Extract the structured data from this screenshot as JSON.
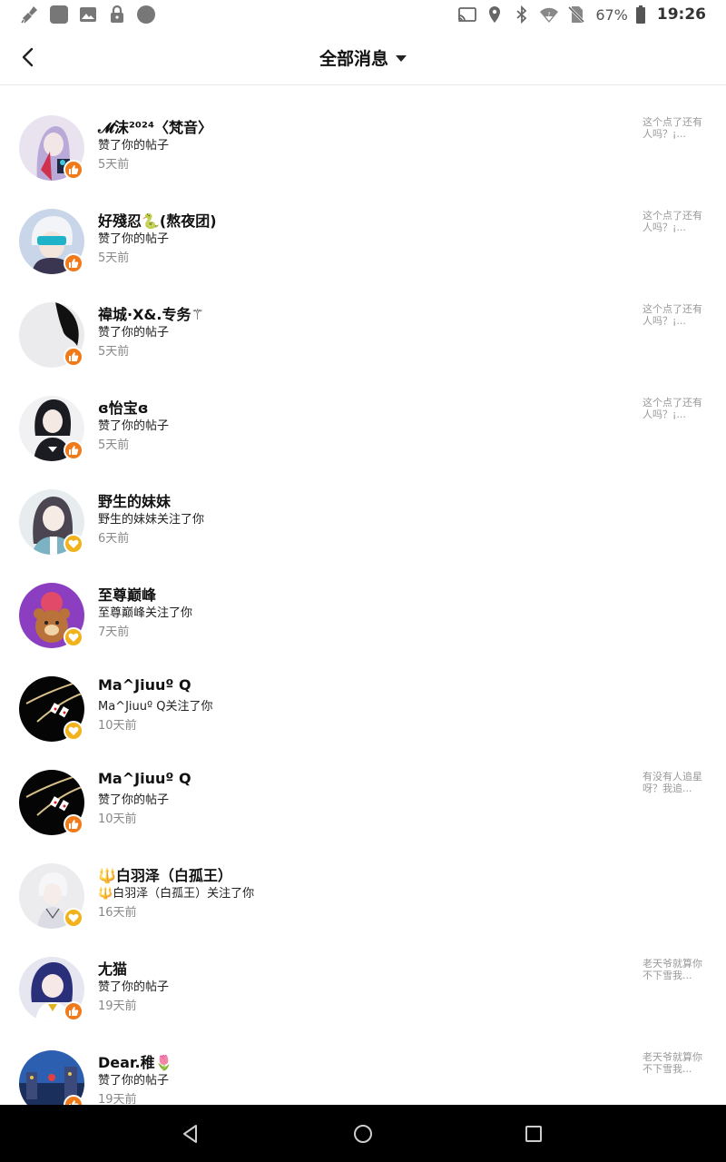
{
  "status_bar": {
    "left_icons": [
      "broom-icon",
      "app-square-icon",
      "image-icon",
      "lock-icon",
      "circle-icon"
    ],
    "right_icons": [
      "cast-icon",
      "location-icon",
      "bluetooth-icon",
      "wifi-icon",
      "no-sim-icon",
      "battery-icon"
    ],
    "battery": "67%",
    "time": "19:26"
  },
  "header": {
    "back_icon": "chevron-left-icon",
    "title": "全部消息",
    "caret_icon": "caret-down-icon"
  },
  "colors": {
    "like_badge": "#f07a1a",
    "follow_badge": "#f2b21b",
    "muted_text": "#888888",
    "preview_text": "#999999"
  },
  "notifications": [
    {
      "name": "𝓜沫²⁰²⁴〈梵音〉",
      "action": "赞了你的帖子",
      "time": "5天前",
      "preview": "这个点了还有人吗？¡...",
      "badge": "like",
      "avatar": "purple-hair-avatar"
    },
    {
      "name": "好殘忍🐍(熬夜团)",
      "action": "赞了你的帖子",
      "time": "5天前",
      "preview": "这个点了还有人吗？¡...",
      "badge": "like",
      "avatar": "white-hair-visor-avatar"
    },
    {
      "name": "禕城·X&.专务⚚",
      "action": "赞了你的帖子",
      "time": "5天前",
      "preview": "这个点了还有人吗？¡...",
      "badge": "like",
      "avatar": "white-black-avatar"
    },
    {
      "name": "ɞ怡宝ɞ",
      "action": "赞了你的帖子",
      "time": "5天前",
      "preview": "这个点了还有人吗？¡...",
      "badge": "like",
      "avatar": "dark-hair-girl-avatar"
    },
    {
      "name": "野生的妹妹",
      "action": "野生的妹妹关注了你",
      "time": "6天前",
      "preview": "",
      "badge": "follow",
      "avatar": "anime-girl-avatar"
    },
    {
      "name": "至尊巅峰",
      "action": "至尊巅峰关注了你",
      "time": "7天前",
      "preview": "",
      "badge": "follow",
      "avatar": "purple-bear-avatar"
    },
    {
      "name": "Ma^Jiuuº Q",
      "action": "Ma^Jiuuº Q关注了你",
      "time": "10天前",
      "preview": "",
      "badge": "follow",
      "avatar": "black-chain-avatar"
    },
    {
      "name": "Ma^Jiuuº Q",
      "action": "赞了你的帖子",
      "time": "10天前",
      "preview": "有没有人追星呀？我追...",
      "badge": "like",
      "avatar": "black-chain-avatar"
    },
    {
      "name": "🔱白羽泽（白孤王）",
      "action": "🔱白羽泽（白孤王）关注了你",
      "time": "16天前",
      "preview": "",
      "badge": "follow",
      "avatar": "white-boy-avatar"
    },
    {
      "name": "尢猫",
      "action": "赞了你的帖子",
      "time": "19天前",
      "preview": "老天爷就算你不下雪我...",
      "badge": "like",
      "avatar": "navy-hair-avatar"
    },
    {
      "name": "Dear.稚🌷",
      "action": "赞了你的帖子",
      "time": "19天前",
      "preview": "老天爷就算你不下雪我...",
      "badge": "like",
      "avatar": "night-city-avatar"
    }
  ],
  "nav_bar": {
    "back": "nav-back-icon",
    "home": "nav-home-icon",
    "recents": "nav-recents-icon"
  }
}
